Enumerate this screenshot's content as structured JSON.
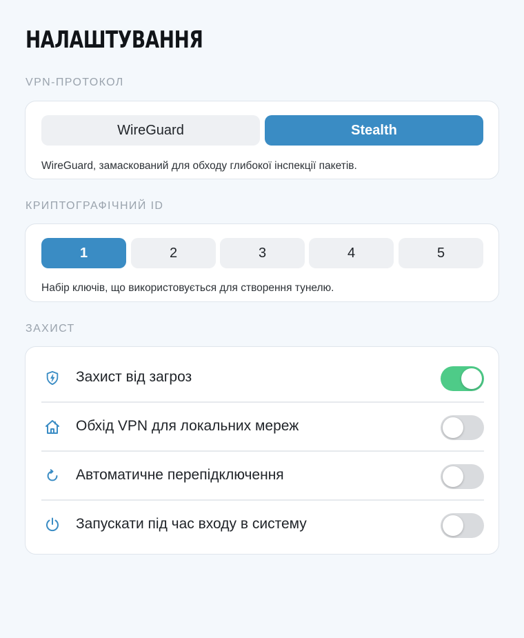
{
  "title": "НАЛАШТУВАННЯ",
  "protocol": {
    "section_label": "VPN-ПРОТОКОЛ",
    "options": [
      "WireGuard",
      "Stealth"
    ],
    "selected": "Stealth",
    "note": "WireGuard, замаскований для обходу глибокої інспекції пакетів."
  },
  "crypto": {
    "section_label": "КРИПТОГРАФІЧНИЙ ID",
    "options": [
      "1",
      "2",
      "3",
      "4",
      "5"
    ],
    "selected": "1",
    "note": "Набір ключів, що використовується для створення тунелю."
  },
  "protection": {
    "section_label": "ЗАХИСТ",
    "items": [
      {
        "label": "Захист від загроз",
        "icon": "shield-bolt-icon",
        "enabled": true
      },
      {
        "label": "Обхід VPN для локальних мереж",
        "icon": "home-icon",
        "enabled": false
      },
      {
        "label": "Автоматичне перепідключення",
        "icon": "refresh-icon",
        "enabled": false
      },
      {
        "label": "Запускати під час входу в систему",
        "icon": "power-icon",
        "enabled": false
      }
    ]
  },
  "colors": {
    "accent": "#3a8cc4",
    "toggle_on": "#4ecb88",
    "toggle_off": "#d9dbde",
    "background": "#f4f8fc"
  }
}
